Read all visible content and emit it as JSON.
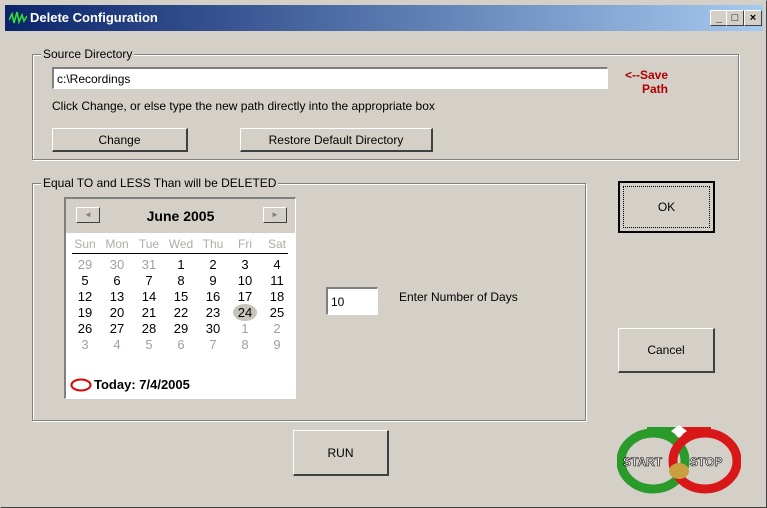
{
  "window": {
    "title": "Delete Configuration",
    "controls": {
      "minimize": "_",
      "maximize": "□",
      "close": "×"
    }
  },
  "source_group": {
    "legend": "Source Directory",
    "path_value": "c:\\Recordings",
    "save_hint": "<--Save",
    "save_hint_2": "Path",
    "instructions": "Click Change, or else type the new path directly into the appropriate box",
    "change_label": "Change",
    "restore_label": "Restore Default Directory"
  },
  "delete_group": {
    "legend": "Equal TO and LESS Than will be DELETED",
    "days_value": "10",
    "days_label": "Enter Number of Days"
  },
  "calendar": {
    "month_title": "June 2005",
    "prev_arrow": "◄",
    "next_arrow": "►",
    "weekdays": [
      "Sun",
      "Mon",
      "Tue",
      "Wed",
      "Thu",
      "Fri",
      "Sat"
    ],
    "weeks": [
      [
        "29",
        "30",
        "31",
        "1",
        "2",
        "3",
        "4"
      ],
      [
        "5",
        "6",
        "7",
        "8",
        "9",
        "10",
        "11"
      ],
      [
        "12",
        "13",
        "14",
        "15",
        "16",
        "17",
        "18"
      ],
      [
        "19",
        "20",
        "21",
        "22",
        "23",
        "24",
        "25"
      ],
      [
        "26",
        "27",
        "28",
        "29",
        "30",
        "1",
        "2"
      ],
      [
        "3",
        "4",
        "5",
        "6",
        "7",
        "8",
        "9"
      ]
    ],
    "selected_day": "24",
    "today_label": "Today: 7/4/2005"
  },
  "buttons": {
    "ok": "OK",
    "cancel": "Cancel",
    "run": "RUN"
  },
  "logo": {
    "left_text": "START",
    "right_text": "STOP"
  },
  "colors": {
    "title_bar_start": "#0a246a",
    "title_bar_end": "#a6caf0",
    "save_hint": "#b00000",
    "face": "#d4d0c8"
  }
}
